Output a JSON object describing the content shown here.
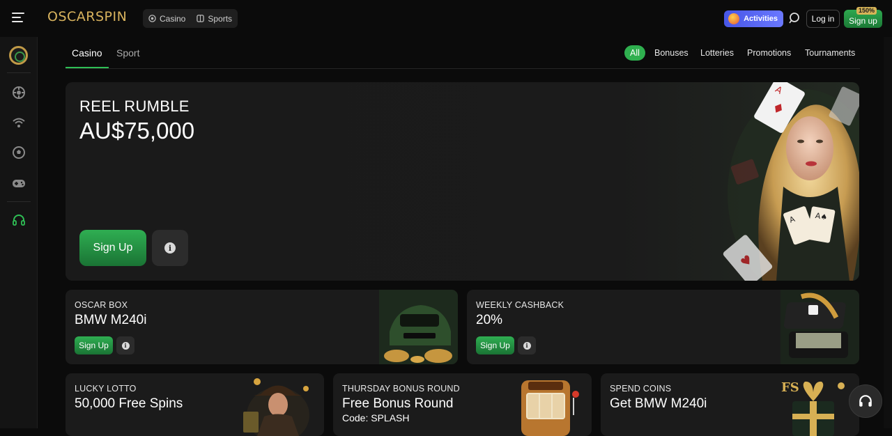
{
  "header": {
    "logo": "OSCARSPIN",
    "tabs": [
      {
        "label": "Casino",
        "icon": "casino-chip-icon"
      },
      {
        "label": "Sports",
        "icon": "sports-ball-icon"
      }
    ],
    "activities_label": "Activities",
    "login_label": "Log in",
    "signup_label": "Sign up",
    "signup_badge": "150%"
  },
  "sidebar": {
    "icons": [
      "oscar-logo-icon",
      "casino-chip-icon",
      "live-signal-icon",
      "football-icon",
      "gamepad-icon",
      "support-headset-icon"
    ]
  },
  "subnav": {
    "tabs": [
      "Casino",
      "Sport"
    ],
    "active_tab": "Casino",
    "filters": [
      "All",
      "Bonuses",
      "Lotteries",
      "Promotions",
      "Tournaments"
    ],
    "active_filter": "All"
  },
  "hero": {
    "title": "REEL RUMBLE",
    "amount": "AU$75,000",
    "signup_label": "Sign Up"
  },
  "cards": [
    {
      "title": "OSCAR BOX",
      "value": "BMW M240i",
      "signup_label": "Sign Up"
    },
    {
      "title": "WEEKLY CASHBACK",
      "value": "20%",
      "signup_label": "Sign Up"
    },
    {
      "title": "LUCKY LOTTO",
      "value": "50,000 Free Spins"
    },
    {
      "title": "THURSDAY BONUS ROUND",
      "value": "Free Bonus Round",
      "code": "Code: SPLASH"
    },
    {
      "title": "SPEND COINS",
      "value": "Get BMW M240i"
    }
  ],
  "colors": {
    "accent_green": "#2fb04f",
    "gold": "#d8b35e",
    "activities_blue": "#5563ee",
    "background": "#0b0b0b",
    "card": "#1b1b1b"
  }
}
